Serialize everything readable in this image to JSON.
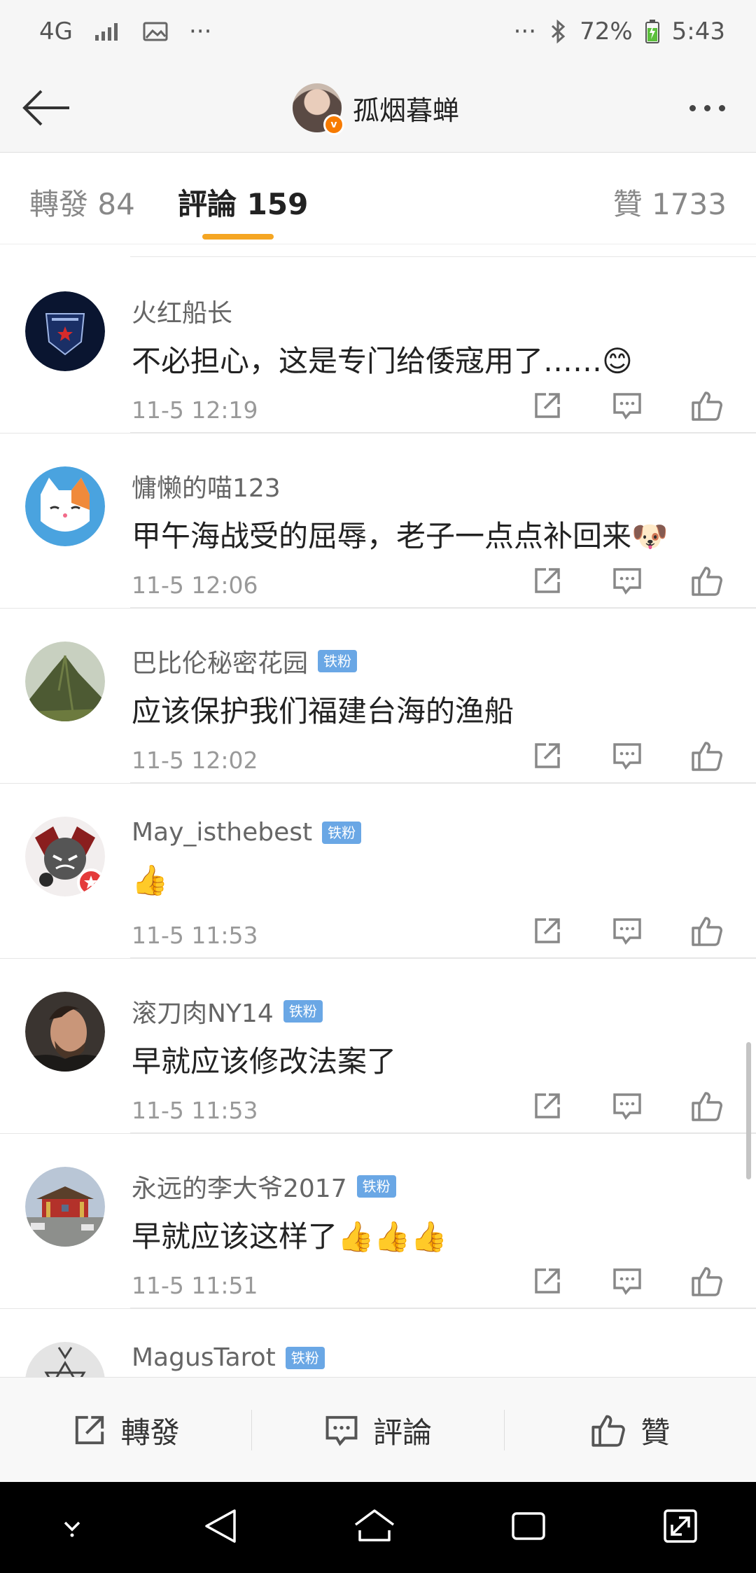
{
  "status_bar": {
    "network": "4G",
    "battery": "72%",
    "time": "5:43",
    "dots": "···"
  },
  "header": {
    "title": "孤烟暮蝉",
    "icons": {
      "back": "back-arrow-icon",
      "more": "more-dots-icon"
    }
  },
  "tabs": {
    "repost": "轉發 84",
    "comments": "評論 159",
    "likes": "贊 1733",
    "active": "comments"
  },
  "comments": [
    {
      "name": "火红船长",
      "badge": "",
      "text": "不必担心，这是专门给倭寇用了……😊",
      "time": "11-5 12:19",
      "avatar": "navy-emblem"
    },
    {
      "name": "慵懒的喵123",
      "badge": "",
      "text": "甲午海战受的屈辱，老子一点点补回来🐶",
      "time": "11-5 12:06",
      "avatar": "cat"
    },
    {
      "name": "巴比伦秘密花园",
      "badge": "铁粉",
      "text": "应该保护我们福建台海的渔船",
      "time": "11-5 12:02",
      "avatar": "mountain"
    },
    {
      "name": "May_isthebest",
      "badge": "铁粉",
      "text": "👍",
      "time": "11-5 11:53",
      "avatar": "cartoon"
    },
    {
      "name": "滚刀肉NY14",
      "badge": "铁粉",
      "text": "早就应该修改法案了",
      "time": "11-5 11:53",
      "avatar": "man"
    },
    {
      "name": "永远的李大爷2017",
      "badge": "铁粉",
      "text": "早就应该这样了👍👍👍",
      "time": "11-5 11:51",
      "avatar": "gate"
    },
    {
      "name": "MagusTarot",
      "badge": "铁粉",
      "text": "",
      "time": "",
      "avatar": "tarot"
    }
  ],
  "bottom_bar": {
    "repost": "轉發",
    "comment": "評論",
    "like": "贊"
  }
}
